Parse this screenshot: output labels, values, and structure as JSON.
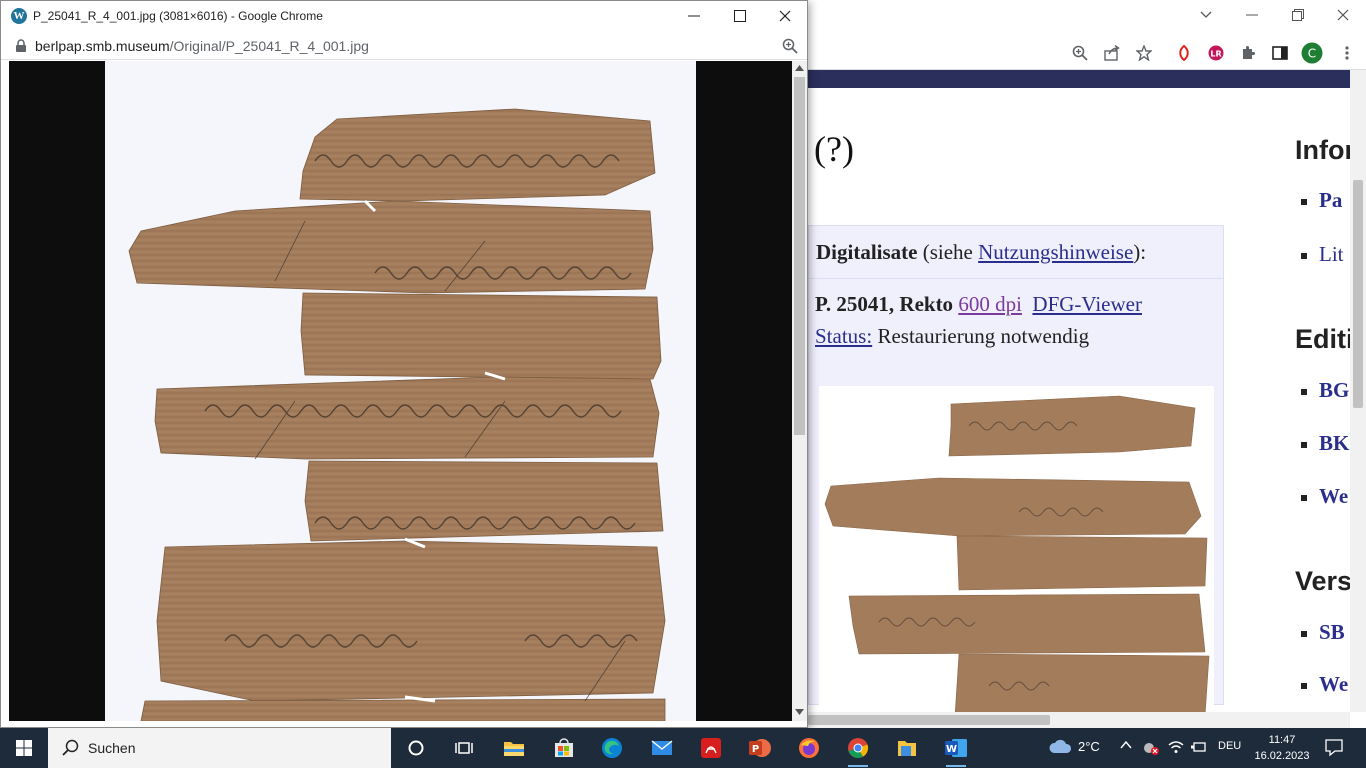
{
  "popup": {
    "title": "P_25041_R_4_001.jpg (3081×6016) - Google Chrome",
    "url_domain": "berlpap.smb.museum",
    "url_path": "/Original/P_25041_R_4_001.jpg"
  },
  "background_page": {
    "heading_fragment": "(?)",
    "digitalisate": {
      "label": "Digitalisate",
      "siehe": "(siehe ",
      "link_nutzung": "Nutzungshinweise",
      "close": "):",
      "item_label": "P. 25041, Rekto",
      "link_dpi": "600 dpi",
      "link_dfg": "DFG-Viewer",
      "status_label": "Status:",
      "status_value": "Restaurierung notwendig"
    },
    "right_column": {
      "heading_1": "Infor",
      "items_1": [
        "Pa",
        "Lit"
      ],
      "heading_2": "Editi",
      "items_2": [
        "BG",
        "BK",
        "We"
      ],
      "heading_3": "Vers",
      "items_3": [
        "SB",
        "We"
      ]
    }
  },
  "taskbar": {
    "search_label": "Suchen",
    "weather_temp": "2°C",
    "language": "DEU",
    "time": "11:47",
    "date": "16.02.2023"
  },
  "profile_initial": "C",
  "colors": {
    "nav_bar": "#2b2f5c",
    "link": "#2a2e8c",
    "visited_link": "#7b3b9c",
    "info_box": "#f0effc",
    "papyrus": "#a07a58",
    "taskbar": "#1d2b3a"
  }
}
